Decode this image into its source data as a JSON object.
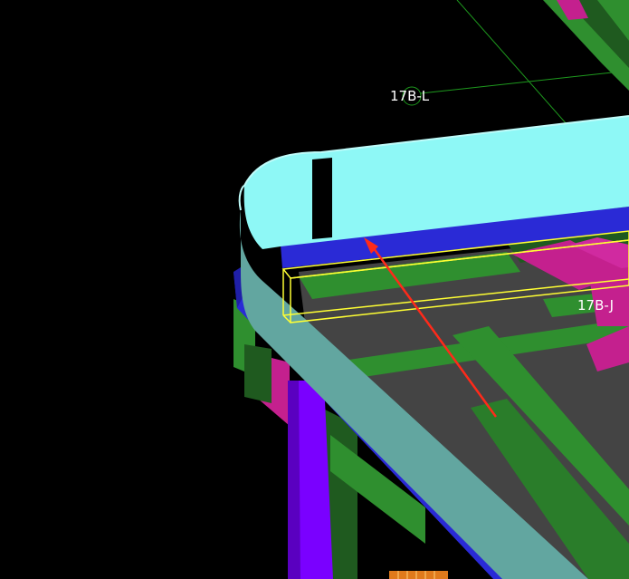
{
  "viewport": {
    "background": "#000000",
    "grid_labels": {
      "label_l": "17B-L",
      "label_j": "17B-J"
    },
    "colors": {
      "cyan_surface": "#8ef8f6",
      "cyan_shaded": "#62a6a0",
      "blue_beam": "#2a2ad6",
      "green_member": "#2f8f2f",
      "dark_green": "#1f5a1f",
      "magenta_plate": "#c4208e",
      "violet_column": "#7a00ff",
      "dark_floor": "#444444",
      "yellow_selection": "#ffff33",
      "red_arrow": "#ff2a1a",
      "grid_line": "#1e9a1e",
      "orange_detail": "#e07a1c"
    }
  }
}
